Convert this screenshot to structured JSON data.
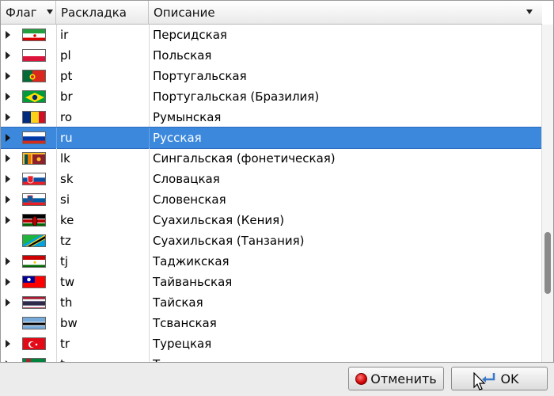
{
  "header": {
    "flag": "Флаг",
    "layout": "Раскладка",
    "description": "Описание"
  },
  "rows": [
    {
      "code": "ir",
      "name": "Персидская",
      "flag": "ir",
      "expander": true
    },
    {
      "code": "pl",
      "name": "Польская",
      "flag": "pl",
      "expander": true
    },
    {
      "code": "pt",
      "name": "Португальская",
      "flag": "pt",
      "expander": true
    },
    {
      "code": "br",
      "name": "Португальская (Бразилия)",
      "flag": "br",
      "expander": true
    },
    {
      "code": "ro",
      "name": "Румынская",
      "flag": "ro",
      "expander": true
    },
    {
      "code": "ru",
      "name": "Русская",
      "flag": "ru",
      "expander": true,
      "selected": true
    },
    {
      "code": "lk",
      "name": "Сингальская (фонетическая)",
      "flag": "lk",
      "expander": true
    },
    {
      "code": "sk",
      "name": "Словацкая",
      "flag": "sk",
      "expander": true
    },
    {
      "code": "si",
      "name": "Словенская",
      "flag": "si",
      "expander": true
    },
    {
      "code": "ke",
      "name": "Суахильская (Кения)",
      "flag": "ke",
      "expander": true
    },
    {
      "code": "tz",
      "name": "Суахильская (Танзания)",
      "flag": "tz",
      "expander": false
    },
    {
      "code": "tj",
      "name": "Таджикская",
      "flag": "tj",
      "expander": true
    },
    {
      "code": "tw",
      "name": "Тайваньская",
      "flag": "tw",
      "expander": true
    },
    {
      "code": "th",
      "name": "Тайская",
      "flag": "th",
      "expander": true
    },
    {
      "code": "bw",
      "name": "Тсванская",
      "flag": "bw",
      "expander": false
    },
    {
      "code": "tr",
      "name": "Турецкая",
      "flag": "tr",
      "expander": true
    },
    {
      "code": "t",
      "name": "Т",
      "flag": "tm",
      "expander": true
    }
  ],
  "scrollbar": {
    "position_fraction": 0.78
  },
  "buttons": {
    "cancel": "Отменить",
    "ok": "OK"
  },
  "colors": {
    "selection": "#3b88dd",
    "cancel_icon": "#d00000",
    "ok_icon": "#3a78c8"
  }
}
